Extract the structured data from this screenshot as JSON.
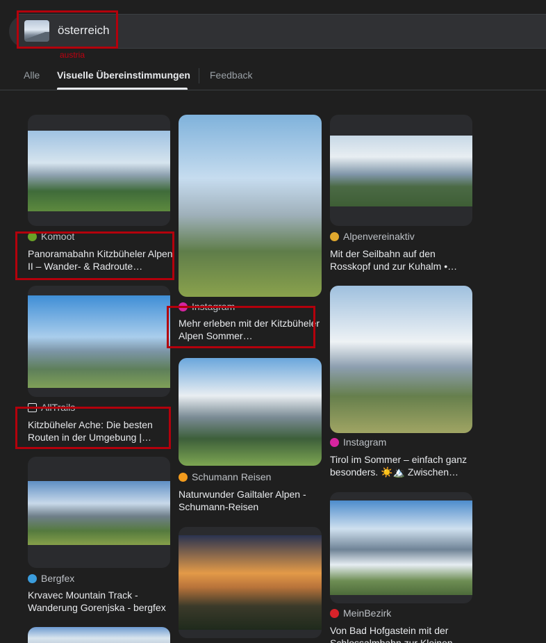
{
  "search": {
    "query": "österreich",
    "transliteration": "austria"
  },
  "tabs": [
    {
      "label": "Alle"
    },
    {
      "label": "Visuelle Übereinstimmungen"
    },
    {
      "label": "Feedback"
    }
  ],
  "results": [
    {
      "source": "Komoot",
      "title": "Panoramabahn Kitzbüheler Alpen II – Wander- & Radroute…",
      "favicon_color": "#6aa127"
    },
    {
      "source": "Instagram",
      "title": "Mehr erleben mit der Kitzbüheler Alpen Sommer…",
      "favicon_color": "#d6249f"
    },
    {
      "source": "Alpenvereinaktiv",
      "title": "Mit der Seilbahn auf den Rosskopf und zur Kuhalm •…",
      "favicon_color": "#e0a82e"
    },
    {
      "source": "AllTrails",
      "title": "Kitzbüheler Ache: Die besten Routen in der Umgebung |…",
      "favicon_color": "#e8eaed"
    },
    {
      "source": "Schumann Reisen",
      "title": "Naturwunder Gailtaler Alpen - Schumann-Reisen",
      "favicon_color": "#f29b1d"
    },
    {
      "source": "Instagram",
      "title": "Tirol im Sommer – einfach ganz besonders. ☀️🏔️ Zwischen…",
      "favicon_color": "#d6249f"
    },
    {
      "source": "Bergfex",
      "title": "Krvavec Mountain Track - Wanderung Gorenjska - bergfex",
      "favicon_color": "#3b9ddd"
    },
    {
      "source": "MeinBezirk",
      "title": "Von Bad Hofgastein mit der Schlossalmbahn zur Kleinen…",
      "favicon_color": "#d8232a"
    }
  ]
}
